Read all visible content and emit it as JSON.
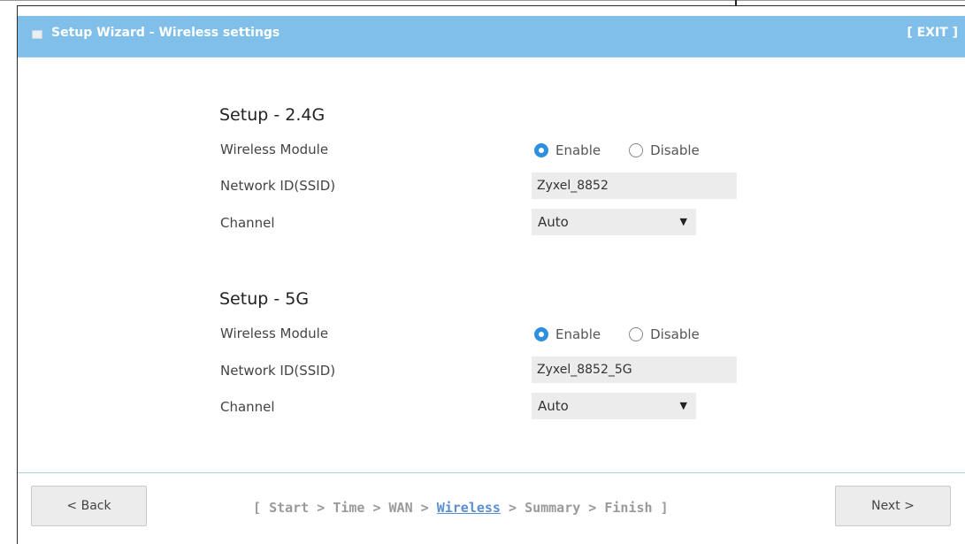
{
  "header": {
    "title": "Setup Wizard - Wireless settings",
    "exit_label": "[ EXIT ]"
  },
  "sections": [
    {
      "title": "Setup - 2.4G",
      "module_label": "Wireless Module",
      "enable_label": "Enable",
      "disable_label": "Disable",
      "module_value": "Enable",
      "ssid_label": "Network ID(SSID)",
      "ssid_value": "Zyxel_8852",
      "channel_label": "Channel",
      "channel_value": "Auto"
    },
    {
      "title": "Setup - 5G",
      "module_label": "Wireless Module",
      "enable_label": "Enable",
      "disable_label": "Disable",
      "module_value": "Enable",
      "ssid_label": "Network ID(SSID)",
      "ssid_value": "Zyxel_8852_5G",
      "channel_label": "Channel",
      "channel_value": "Auto"
    }
  ],
  "footer": {
    "back_label": "< Back",
    "next_label": "Next >",
    "steps_open": "[ ",
    "steps": [
      "Start",
      "Time",
      "WAN",
      "Wireless",
      "Summary",
      "Finish"
    ],
    "steps_sep": " > ",
    "steps_close": " ]",
    "active_step": "Wireless"
  },
  "colors": {
    "titlebar": "#7fbfe9",
    "radio_selected": "#2e8ee0",
    "active_step": "#5a8fd0",
    "field_bg": "#ececec"
  },
  "icons": {
    "title_icon": "window-icon",
    "select_arrow": "dropdown-arrow-icon"
  }
}
